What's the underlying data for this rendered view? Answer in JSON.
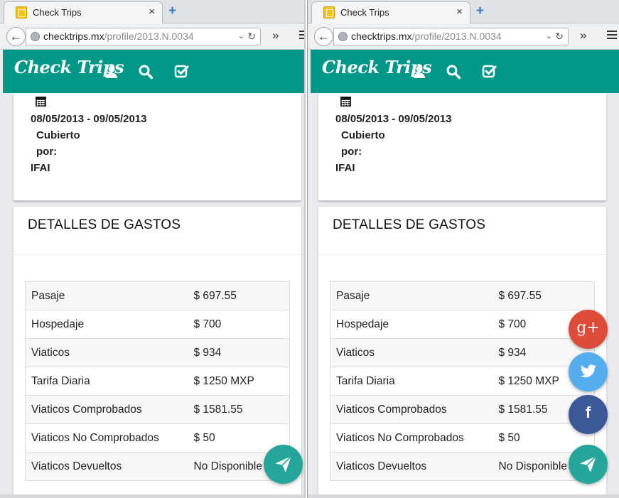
{
  "browser": {
    "tab_title": "Check Trips",
    "tab_close": "×",
    "new_tab": "+",
    "url_domain": "checktrips.mx",
    "url_path": "/profile/2013.N.0034",
    "overflow": "»"
  },
  "app": {
    "logo": "Check Trips",
    "nav_icons": [
      "user-icon",
      "search-icon",
      "check-square-icon"
    ],
    "accent": "#009688"
  },
  "trip": {
    "dates": "08/05/2013 - 09/05/2013",
    "covered_by_label_1": "Cubierto",
    "covered_by_label_2": "por:",
    "covered_by_value": "IFAI"
  },
  "expenses": {
    "title": "DETALLES DE GASTOS",
    "rows": [
      {
        "label": "Pasaje",
        "value": "$ 697.55"
      },
      {
        "label": "Hospedaje",
        "value": "$ 700"
      },
      {
        "label": "Viaticos",
        "value": "$ 934"
      },
      {
        "label": "Tarifa Diaria",
        "value": "$ 1250 MXP"
      },
      {
        "label": "Viaticos Comprobados",
        "value": "$ 1581.55"
      },
      {
        "label": "Viaticos No Comprobados",
        "value": "$ 50"
      },
      {
        "label": "Viaticos Devueltos",
        "value": "No Disponible"
      }
    ]
  },
  "share": {
    "google_label": "g+",
    "facebook_label": "f",
    "colors": {
      "google": "#dd4b39",
      "twitter": "#55acee",
      "facebook": "#3b5998",
      "send": "#26a69a"
    }
  }
}
